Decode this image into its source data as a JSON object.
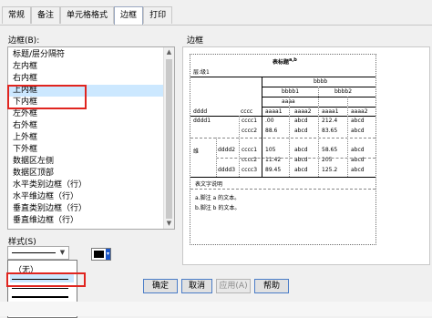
{
  "tabs": [
    "常规",
    "备注",
    "单元格格式",
    "边框",
    "打印"
  ],
  "active_tab": "边框",
  "border_list_label": "边框(B):",
  "border_items": [
    "标题/层分隔符",
    "左内框",
    "右内框",
    "上内框",
    "下内框",
    "左外框",
    "右外框",
    "上外框",
    "下外框",
    "数据区左侧",
    "数据区顶部",
    "水平类别边框（行）",
    "水平维边框（行）",
    "垂直类别边框（行）",
    "垂直维边框（行）"
  ],
  "selected_item": "上内框",
  "style_label": "样式(S)",
  "style_none": "（无）",
  "buttons": {
    "ok": "确定",
    "cancel": "取消",
    "apply": "应用(A)",
    "help": "帮助"
  },
  "preview_label": "边框",
  "preview": {
    "title": "表标题",
    "title_sup": "a,b",
    "layer": "层:级1",
    "bbbb": "bbbb",
    "bbbb1": "bbbb1",
    "bbbb2": "bbbb2",
    "aaaa": "aaaa",
    "col_heads": [
      "aaaa1",
      "aaaa2",
      "aaaa1",
      "aaaa2"
    ],
    "dddd": "dddd",
    "cccc": "cccc",
    "dddd1": "dddd1",
    "dddd2": "dddd2",
    "dddd3": "dddd3",
    "group": "维",
    "cccc1": "cccc1",
    "cccc2": "cccc2",
    "cccc3": "cccc3",
    "rows": [
      [
        "cccc1",
        ".00",
        "abcd",
        "212.4",
        "abcd"
      ],
      [
        "cccc2",
        "88.6",
        "abcd",
        "83.65",
        "abcd"
      ],
      [
        "cccc1",
        "105",
        "abcd",
        "58.65",
        "abcd"
      ],
      [
        "cccc2",
        "11.42",
        "abcd",
        "205",
        "abcd"
      ],
      [
        "cccc3",
        "89.45",
        "abcd",
        "125.2",
        "abcd"
      ]
    ],
    "note_title": "表文字说明",
    "note_a": "a.脚注 a 的文本。",
    "note_b": "b.脚注 b 的文本。"
  }
}
